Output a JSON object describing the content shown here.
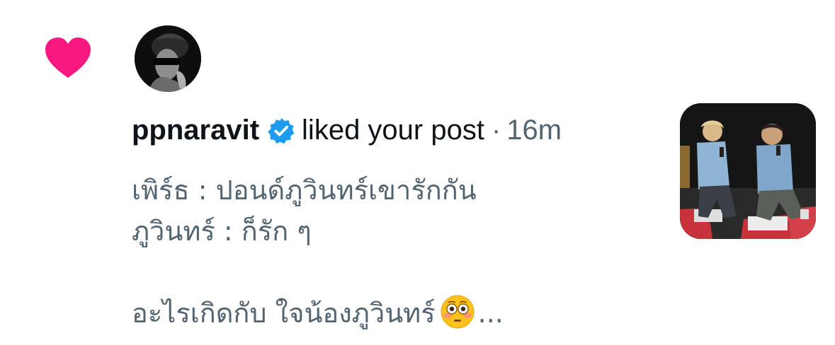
{
  "notification": {
    "type": "like",
    "heart_color": "#f91880",
    "avatar_icon": "avatar-photo",
    "username": "ppnaravit",
    "verified_color": "#1d9bf0",
    "action": "liked your post",
    "separator": "·",
    "time": "16m",
    "post": {
      "line1": "เพิร์ธ : ปอนด์ภูวินทร์เขารักกัน",
      "line2": "ภูวินทร์ : ก็รัก ๆ",
      "line3": "อะไรเกิดกับ ใจน้องภูวินทร์",
      "emoji": "flushed-face-icon",
      "ellipsis": "..."
    },
    "thumbnail_icon": "post-photo"
  }
}
